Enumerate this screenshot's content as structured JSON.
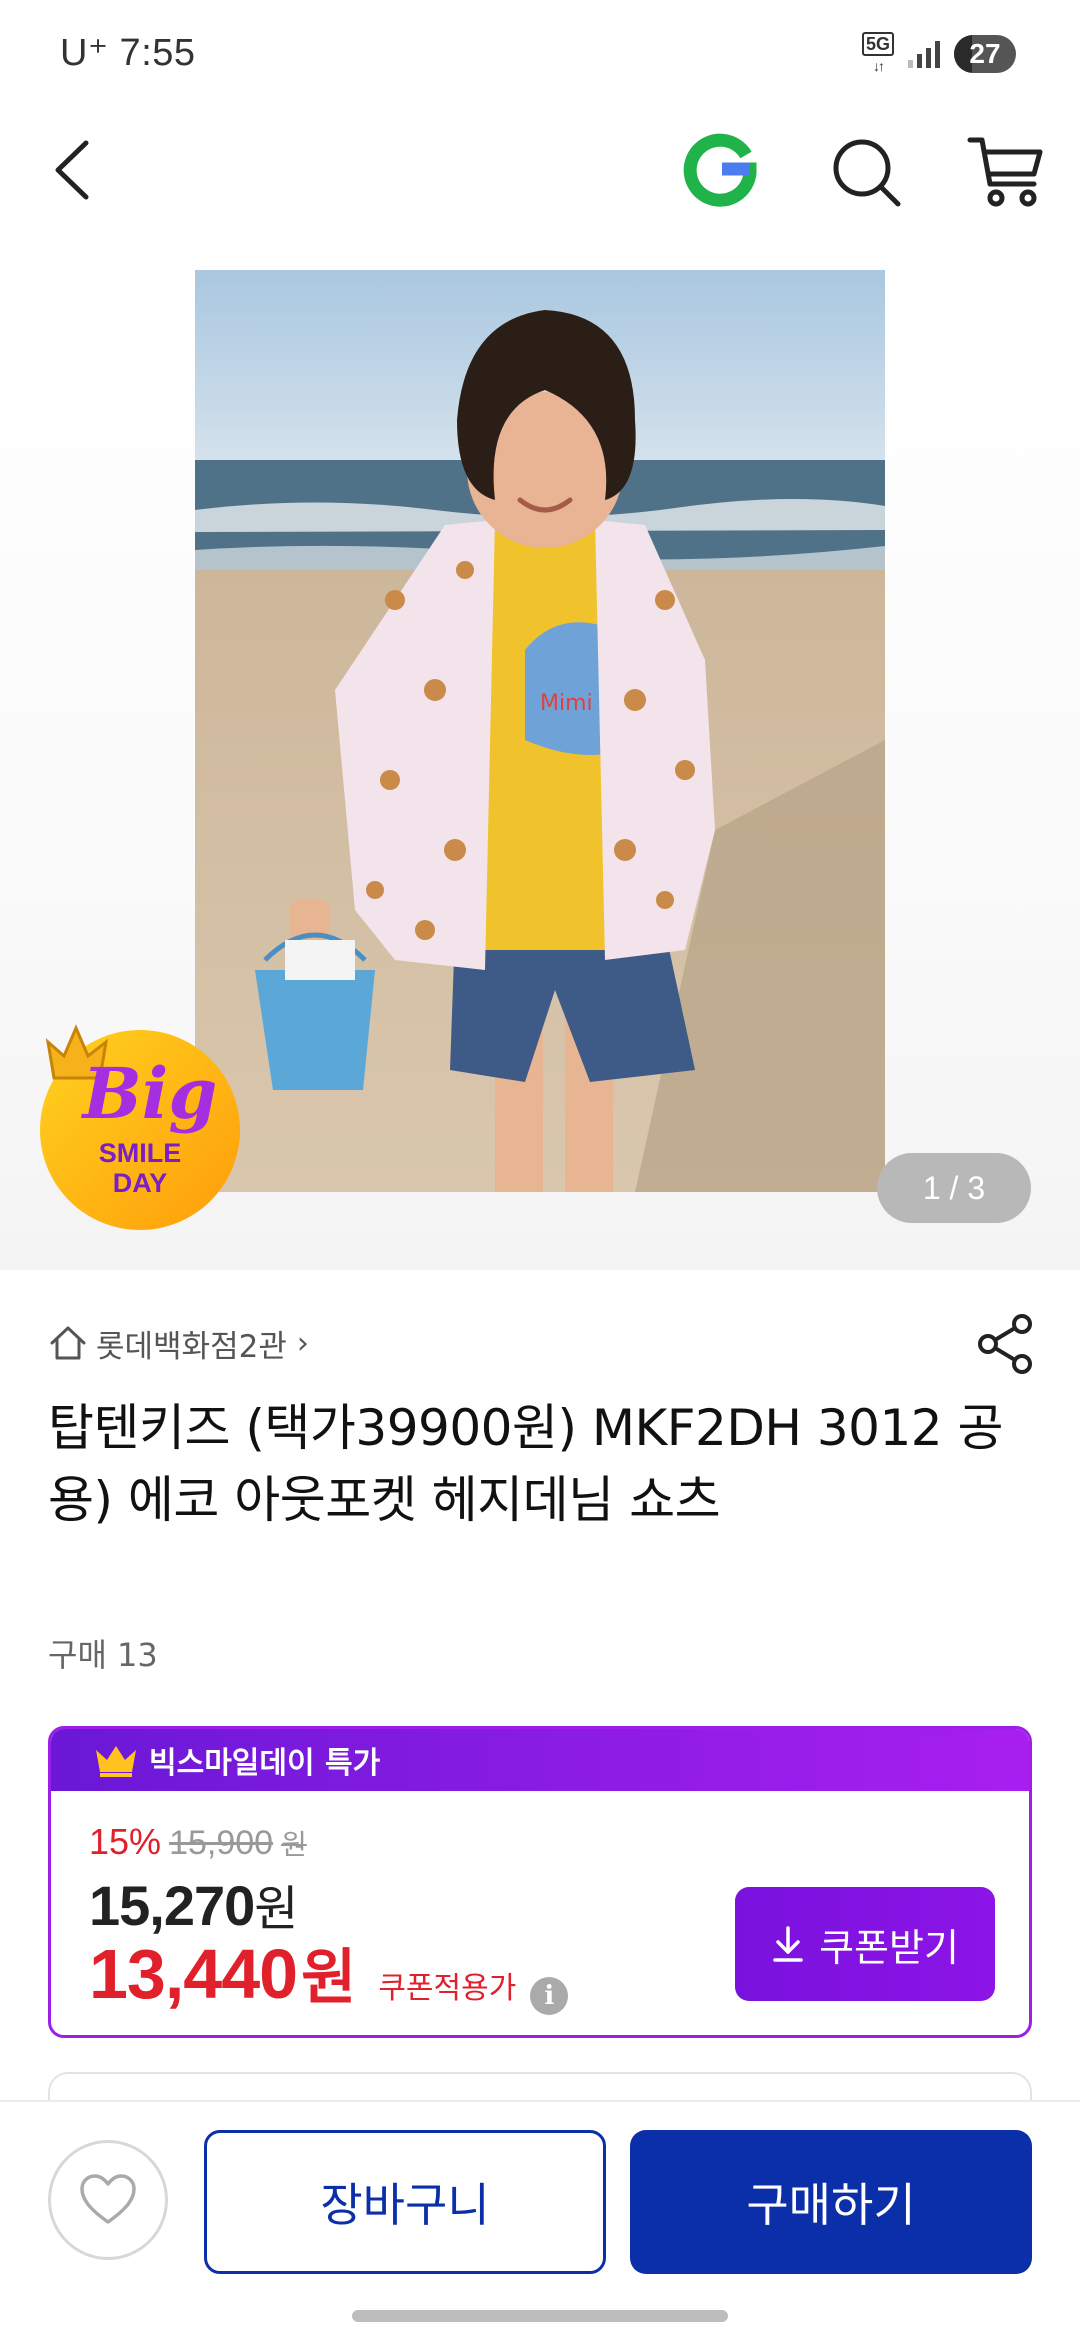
{
  "status_bar": {
    "carrier_time": "U⁺ 7:55",
    "network": "5G",
    "battery": "27"
  },
  "nav": {
    "back_icon": "back-arrow-icon",
    "logo_icon": "gmarket-g-logo-icon",
    "search_icon": "search-icon",
    "cart_icon": "cart-icon"
  },
  "gallery": {
    "page_indicator": "1 / 3",
    "badge": {
      "line1": "Big",
      "line2": "SMILE",
      "line3": "DAY"
    },
    "photo_text": "Mimi Chi"
  },
  "product": {
    "store_name": "롯데백화점2관",
    "store_chevron": "›",
    "title": "탑텐키즈 (택가39900원) MKF2DH 3012 공용) 에코 아웃포켓 헤지데님 쇼츠",
    "purchase_count": "구매 13"
  },
  "price_card": {
    "promo_label": "빅스마일데이 특가",
    "discount_rate": "15%",
    "original_price": "15,900",
    "original_unit": "원",
    "sale_price": "15,270",
    "sale_unit": "원",
    "coupon_price": "13,440",
    "coupon_unit": "원",
    "coupon_applied_label": "쿠폰적용가",
    "info_glyph": "i",
    "coupon_button": "쿠폰받기"
  },
  "bottom_bar": {
    "cart_button": "장바구니",
    "buy_button": "구매하기"
  },
  "colors": {
    "promo_purple": "#8c14e6",
    "price_red": "#e0202a",
    "primary_blue": "#0b2fa8",
    "gmarket_green": "#1fb34a"
  }
}
